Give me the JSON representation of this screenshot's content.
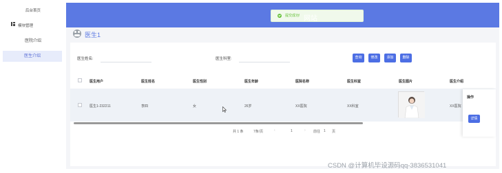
{
  "sidebar": {
    "home": "后台首页",
    "module": "模块管理",
    "items": [
      {
        "label": "医院介绍",
        "active": false
      },
      {
        "label": "医生介绍",
        "active": true
      }
    ]
  },
  "header": {
    "title": "网站",
    "toast": "提交成功!"
  },
  "breadcrumb": {
    "title": "医生1"
  },
  "search": {
    "name_label": "医生姓名:",
    "name_value": "",
    "dept_label": "医生科室:",
    "dept_value": ""
  },
  "buttons": {
    "query": "查询",
    "edit": "修改",
    "add": "添加",
    "delete": "删除"
  },
  "table": {
    "columns": [
      "医生用户",
      "医生姓名",
      "医生性别",
      "医生年龄",
      "医院名称",
      "医生科室",
      "医生图片",
      "医生介绍",
      "操作"
    ],
    "rows": [
      {
        "user": "医生1-232211",
        "name": "李四",
        "gender": "女",
        "age": "26岁",
        "hospital": "XX医院",
        "dept": "XX科室",
        "intro": "XX医院",
        "action": "详情"
      }
    ]
  },
  "pagination": {
    "total": "共 1 条",
    "page_size": "7条/页",
    "prev": "‹",
    "current": "1",
    "next": "›",
    "goto_label": "前往",
    "goto_value": "1",
    "page_unit": "页"
  },
  "watermark": "CSDN @计算机毕设源码qq-3836531041",
  "colors": {
    "header_bg": "#5b79e3",
    "button_bg": "#4c6ee4",
    "active_menu_bg": "#e7ecfb",
    "toast_green": "#67c23a"
  },
  "icons": [
    "module-icon",
    "success-icon",
    "avatar-icon",
    "cursor-icon"
  ]
}
